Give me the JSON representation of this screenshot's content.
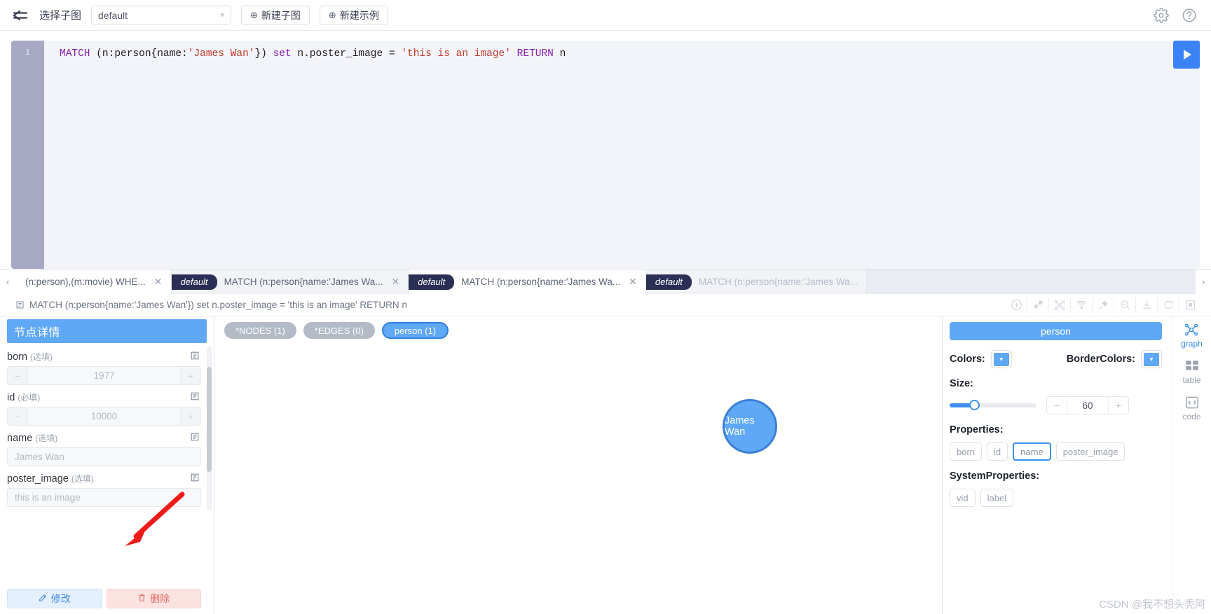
{
  "topbar": {
    "back_icon": "back-arrow-icon",
    "label": "选择子图",
    "select_value": "default",
    "new_subgraph": "新建子图",
    "new_example": "新建示例",
    "gear_icon": "gear-icon",
    "help_icon": "help-icon"
  },
  "editor": {
    "line_number": "1",
    "tokens": [
      {
        "t": "MATCH ",
        "c": "kw"
      },
      {
        "t": "(n:person{name:",
        "c": "plain"
      },
      {
        "t": "'James Wan'",
        "c": "str"
      },
      {
        "t": "}) ",
        "c": "plain"
      },
      {
        "t": "set ",
        "c": "kw"
      },
      {
        "t": "n.poster_image = ",
        "c": "plain"
      },
      {
        "t": "'this is an image'",
        "c": "str"
      },
      {
        "t": " RETURN ",
        "c": "kw"
      },
      {
        "t": "n",
        "c": "plain"
      }
    ],
    "run_button": "run-query-button"
  },
  "tabs": {
    "prev_arrow": "‹",
    "next_arrow": "›",
    "items": [
      {
        "badge": "",
        "text": "(n:person),(m:movie) WHE...",
        "state": "white",
        "closable": true
      },
      {
        "badge": "default",
        "text": "MATCH (n:person{name:'James Wa...",
        "state": "gray",
        "closable": true
      },
      {
        "badge": "default",
        "text": "MATCH (n:person{name:'James Wa...",
        "state": "white",
        "closable": true
      },
      {
        "badge": "default",
        "text": "MATCH (n:person{name:'James Wa...",
        "state": "gray",
        "closable": true,
        "muted": true
      }
    ]
  },
  "query_row": {
    "copy_icon": "copy-icon",
    "text": "MATCH (n:person{name:'James Wan'}) set n.poster_image = 'this is an image' RETURN n",
    "tools": [
      "add-node-icon",
      "relation-icon",
      "expand-graph-icon",
      "align-icon",
      "pin-icon",
      "zoom-fit-icon",
      "download-icon",
      "refresh-icon",
      "fullscreen-icon"
    ]
  },
  "left_panel": {
    "title": "节点详情",
    "fields": [
      {
        "name": "born",
        "req": "(选填)",
        "type": "number",
        "value": "1977",
        "copy": "copy-icon"
      },
      {
        "name": "id",
        "req": "(必填)",
        "type": "number",
        "value": "10000",
        "copy": "copy-icon"
      },
      {
        "name": "name",
        "req": "(选填)",
        "type": "text",
        "value": "James Wan",
        "copy": "copy-icon"
      },
      {
        "name": "poster_image",
        "req": "(选填)",
        "type": "text",
        "value": "this is an image",
        "copy": "copy-icon"
      }
    ],
    "edit_button": "修改",
    "delete_button": "删除",
    "edit_icon": "edit-icon",
    "delete_icon": "trash-icon"
  },
  "canvas": {
    "chips": [
      {
        "label": "*NODES (1)",
        "style": "gray"
      },
      {
        "label": "*EDGES (0)",
        "style": "gray"
      },
      {
        "label": "person (1)",
        "style": "blue"
      }
    ],
    "node": {
      "label": "James Wan",
      "fill": "#5fa8f5",
      "stroke": "#3a7fd5"
    }
  },
  "right_panel": {
    "title": "person",
    "colors_label": "Colors:",
    "border_colors_label": "BorderColors:",
    "color_value": "#5fa8f5",
    "border_color_value": "#5fa8f5",
    "size_label": "Size:",
    "size_value": "60",
    "properties_label": "Properties:",
    "properties": [
      {
        "label": "born",
        "selected": false
      },
      {
        "label": "id",
        "selected": false
      },
      {
        "label": "name",
        "selected": true
      },
      {
        "label": "poster_image",
        "selected": false
      }
    ],
    "system_properties_label": "SystemProperties:",
    "system_properties": [
      {
        "label": "vid",
        "selected": false
      },
      {
        "label": "label",
        "selected": false
      }
    ]
  },
  "rail": {
    "items": [
      {
        "label": "graph",
        "icon": "graph-icon",
        "active": true
      },
      {
        "label": "table",
        "icon": "table-icon",
        "active": false
      },
      {
        "label": "code",
        "icon": "code-icon",
        "active": false
      }
    ]
  },
  "watermark": "CSDN @我不想头秃阿"
}
